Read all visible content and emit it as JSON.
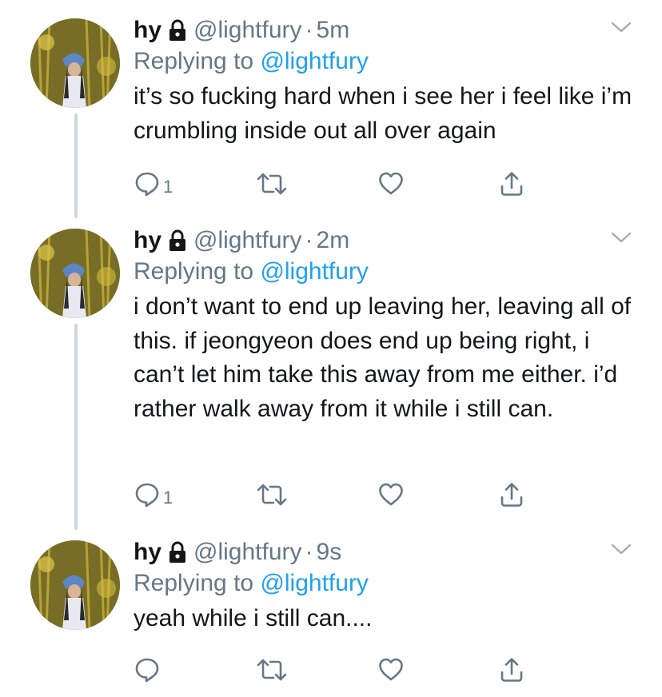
{
  "colors": {
    "text": "#14171a",
    "secondary": "#657786",
    "link": "#1da1f2",
    "thread_line": "#ccd6dd"
  },
  "tweets": [
    {
      "name": "hy",
      "handle": "@lightfury",
      "separator": "·",
      "time": "5m",
      "replying_prefix": "Replying to",
      "replying_to": "@lightfury",
      "text": "it’s so fucking hard when i see her i feel like i’m crumbling inside out all over again",
      "reply_count": "1",
      "icons": [
        "lock-icon",
        "chevron-down-icon",
        "reply-icon",
        "retweet-icon",
        "like-icon",
        "share-icon"
      ]
    },
    {
      "name": "hy",
      "handle": "@lightfury",
      "separator": "·",
      "time": "2m",
      "replying_prefix": "Replying to",
      "replying_to": "@lightfury",
      "text": "i don’t want to end up leaving her, leaving all of this. if jeongyeon does end up being right, i can’t let him take this away from me either. i’d rather walk away from it while i still can.",
      "reply_count": "1",
      "icons": [
        "lock-icon",
        "chevron-down-icon",
        "reply-icon",
        "retweet-icon",
        "like-icon",
        "share-icon"
      ]
    },
    {
      "name": "hy",
      "handle": "@lightfury",
      "separator": "·",
      "time": "9s",
      "replying_prefix": "Replying to",
      "replying_to": "@lightfury",
      "text": "yeah while i still can....",
      "reply_count": "",
      "icons": [
        "lock-icon",
        "chevron-down-icon",
        "reply-icon",
        "retweet-icon",
        "like-icon",
        "share-icon"
      ]
    }
  ]
}
